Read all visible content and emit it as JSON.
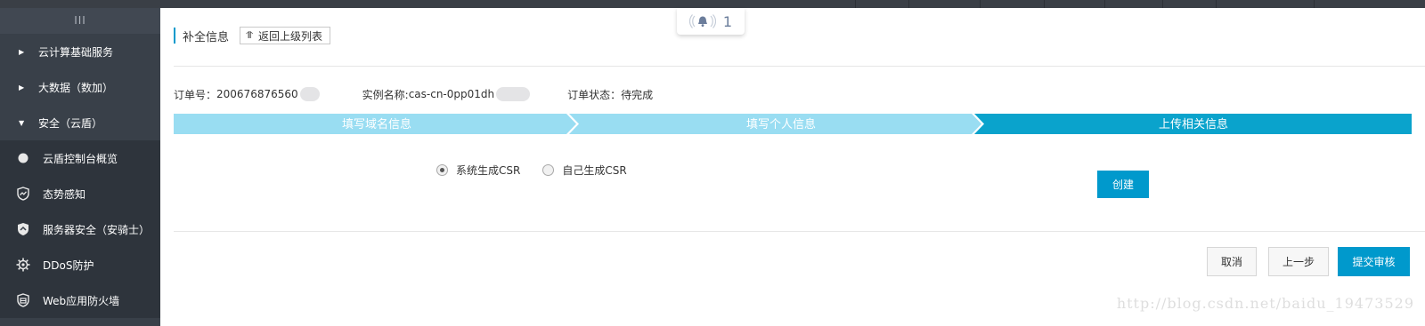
{
  "sidebar": {
    "handle": "III",
    "groups": [
      {
        "label": "云计算基础服务",
        "expanded": false
      },
      {
        "label": "大数据（数加）",
        "expanded": false
      },
      {
        "label": "安全（云盾）",
        "expanded": true
      }
    ],
    "items": [
      {
        "label": "云盾控制台概览",
        "icon": "dot-icon"
      },
      {
        "label": "态势感知",
        "icon": "trend-shield-icon"
      },
      {
        "label": "服务器安全（安骑士）",
        "icon": "server-shield-icon"
      },
      {
        "label": "DDoS防护",
        "icon": "gear-icon"
      },
      {
        "label": "Web应用防火墙",
        "icon": "firewall-shield-icon"
      }
    ]
  },
  "header": {
    "title": "补全信息",
    "back_label": "返回上级列表",
    "notification_count": "1"
  },
  "order": {
    "number_label": "订单号：",
    "number_value": "200676876560",
    "instance_label": "实例名称: ",
    "instance_value": "cas-cn-0pp01dh",
    "status_label": "订单状态：",
    "status_value": "待完成"
  },
  "steps": [
    {
      "label": "填写域名信息",
      "state": "done"
    },
    {
      "label": "填写个人信息",
      "state": "done"
    },
    {
      "label": "上传相关信息",
      "state": "active"
    }
  ],
  "csr": {
    "options": [
      {
        "label": "系统生成CSR",
        "selected": true
      },
      {
        "label": "自己生成CSR",
        "selected": false
      }
    ],
    "create_label": "创建"
  },
  "footer": {
    "cancel_label": "取消",
    "prev_label": "上一步",
    "submit_label": "提交审核"
  },
  "watermark": "http://blog.csdn.net/baidu_19473529",
  "colors": {
    "sidebar_bg": "#394049",
    "accent": "#0099cc",
    "step_done": "#99ddf2",
    "step_active": "#0aa3cc"
  }
}
